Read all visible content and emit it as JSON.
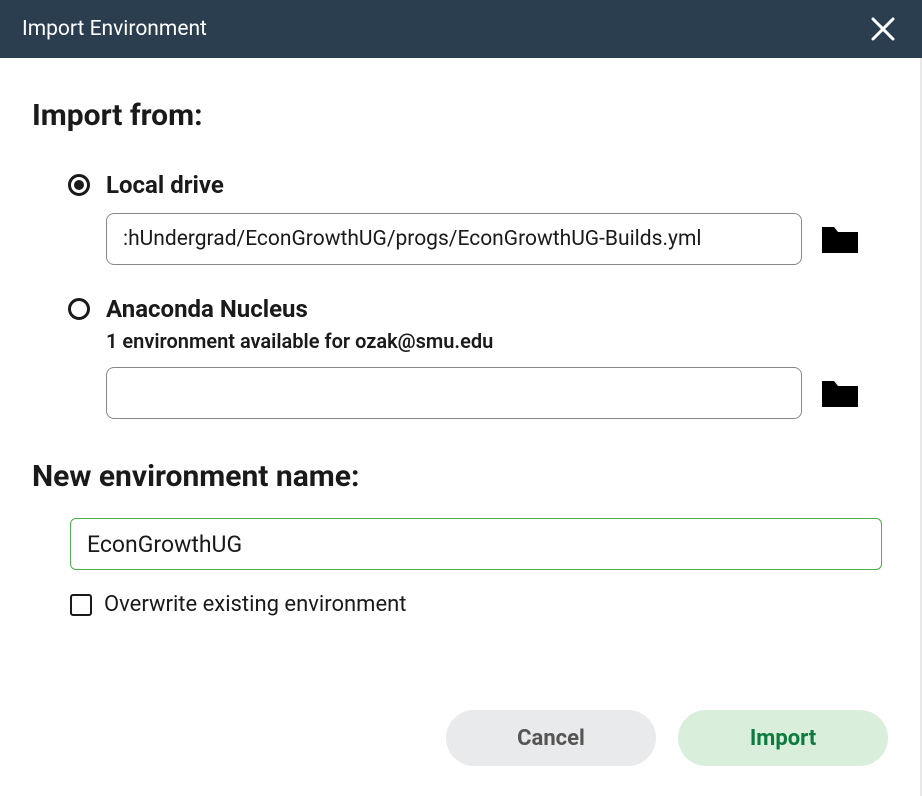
{
  "titlebar": {
    "title": "Import Environment"
  },
  "heading": "Import from:",
  "sources": {
    "local": {
      "label": "Local drive",
      "path": ":hUndergrad/EconGrowthUG/progs/EconGrowthUG-Builds.yml",
      "selected": true
    },
    "nucleus": {
      "label": "Anaconda Nucleus",
      "subtext": "1 environment available for ozak@smu.edu",
      "path": "",
      "selected": false
    }
  },
  "env_name": {
    "heading": "New environment name:",
    "value": "EconGrowthUG"
  },
  "overwrite": {
    "label": "Overwrite existing environment",
    "checked": false
  },
  "buttons": {
    "cancel": "Cancel",
    "import": "Import"
  }
}
